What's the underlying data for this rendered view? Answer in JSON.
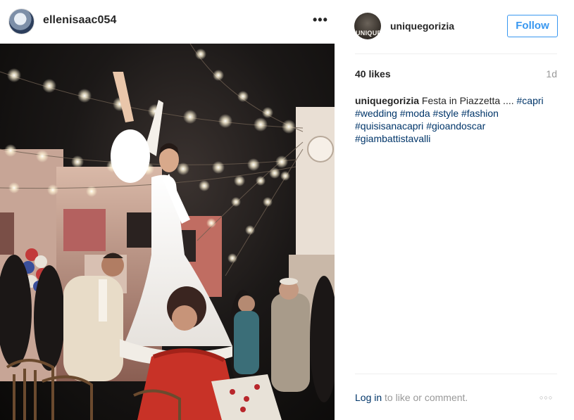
{
  "post_header": {
    "username": "ellenisaac054",
    "more_icon": "more-horizontal-icon",
    "more_glyph": "•••"
  },
  "side_header": {
    "username": "uniquegorizia",
    "avatar_text": "UNIQUE",
    "follow_label": "Follow"
  },
  "stats": {
    "likes": "40 likes",
    "age": "1d"
  },
  "caption": {
    "username": "uniquegorizia",
    "text": "Festa in Piazzetta ....",
    "hashtags": [
      "#capri",
      "#wedding",
      "#moda",
      "#style",
      "#fashion",
      "#quisisanacapri",
      "#gioandoscar",
      "#giambattistavalli"
    ]
  },
  "footer": {
    "login_label": "Log in",
    "login_suffix": "to like or comment.",
    "options_icon": "options-icon",
    "options_glyph": "○○○"
  },
  "colors": {
    "accent": "#3897f0",
    "hashtag": "#003569",
    "muted": "#999999",
    "text": "#262626"
  }
}
